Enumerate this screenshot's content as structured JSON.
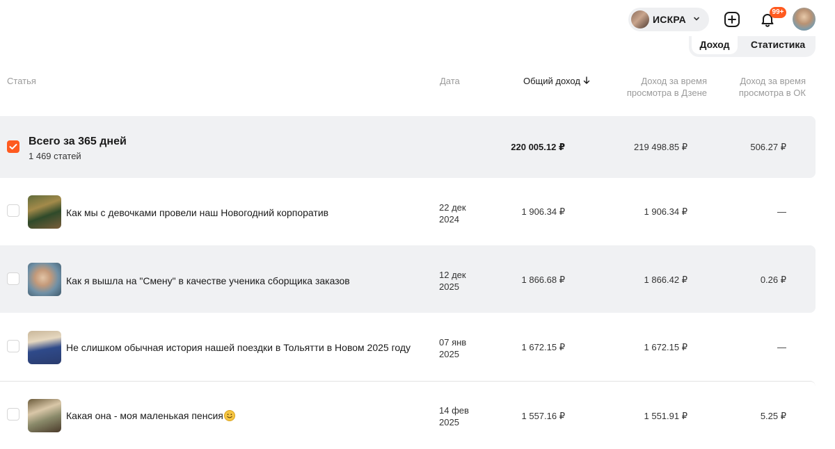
{
  "header": {
    "channel_name": "ИСКРА",
    "notifications_badge": "99+"
  },
  "tabs": [
    {
      "label": "Доход",
      "active": true
    },
    {
      "label": "Статистика",
      "active": false
    }
  ],
  "table": {
    "columns": {
      "article": "Статья",
      "date": "Дата",
      "total_income": "Общий доход",
      "dzen_income_l1": "Доход за время",
      "dzen_income_l2": "просмотра в Дзене",
      "ok_income_l1": "Доход за время",
      "ok_income_l2": "просмотра в ОК"
    },
    "total": {
      "title": "Всего за 365 дней",
      "subtitle": "1 469 статей",
      "total_income": "220 005.12 ₽",
      "dzen_income": "219 498.85 ₽",
      "ok_income": "506.27 ₽"
    },
    "rows": [
      {
        "title": "Как мы с девочками провели наш Новогодний корпоратив",
        "date_l1": "22 дек",
        "date_l2": "2024",
        "total_income": "1 906.34 ₽",
        "dzen_income": "1 906.34 ₽",
        "ok_income": "—"
      },
      {
        "title": "Как я вышла на \"Смену\" в качестве ученика сборщика заказов",
        "date_l1": "12 дек",
        "date_l2": "2025",
        "total_income": "1 866.68 ₽",
        "dzen_income": "1 866.42 ₽",
        "ok_income": "0.26 ₽"
      },
      {
        "title": "Не слишком обычная история нашей поездки в Тольятти в Новом 2025 году",
        "date_l1": "07 янв",
        "date_l2": "2025",
        "total_income": "1 672.15 ₽",
        "dzen_income": "1 672.15 ₽",
        "ok_income": "—"
      },
      {
        "title": "Какая она - моя маленькая пенсия",
        "date_l1": "14 фев",
        "date_l2": "2025",
        "total_income": "1 557.16 ₽",
        "dzen_income": "1 551.91 ₽",
        "ok_income": "5.25 ₽"
      }
    ]
  },
  "colors": {
    "accent": "#ff5a1f",
    "row_shade": "#f0f1f3"
  }
}
